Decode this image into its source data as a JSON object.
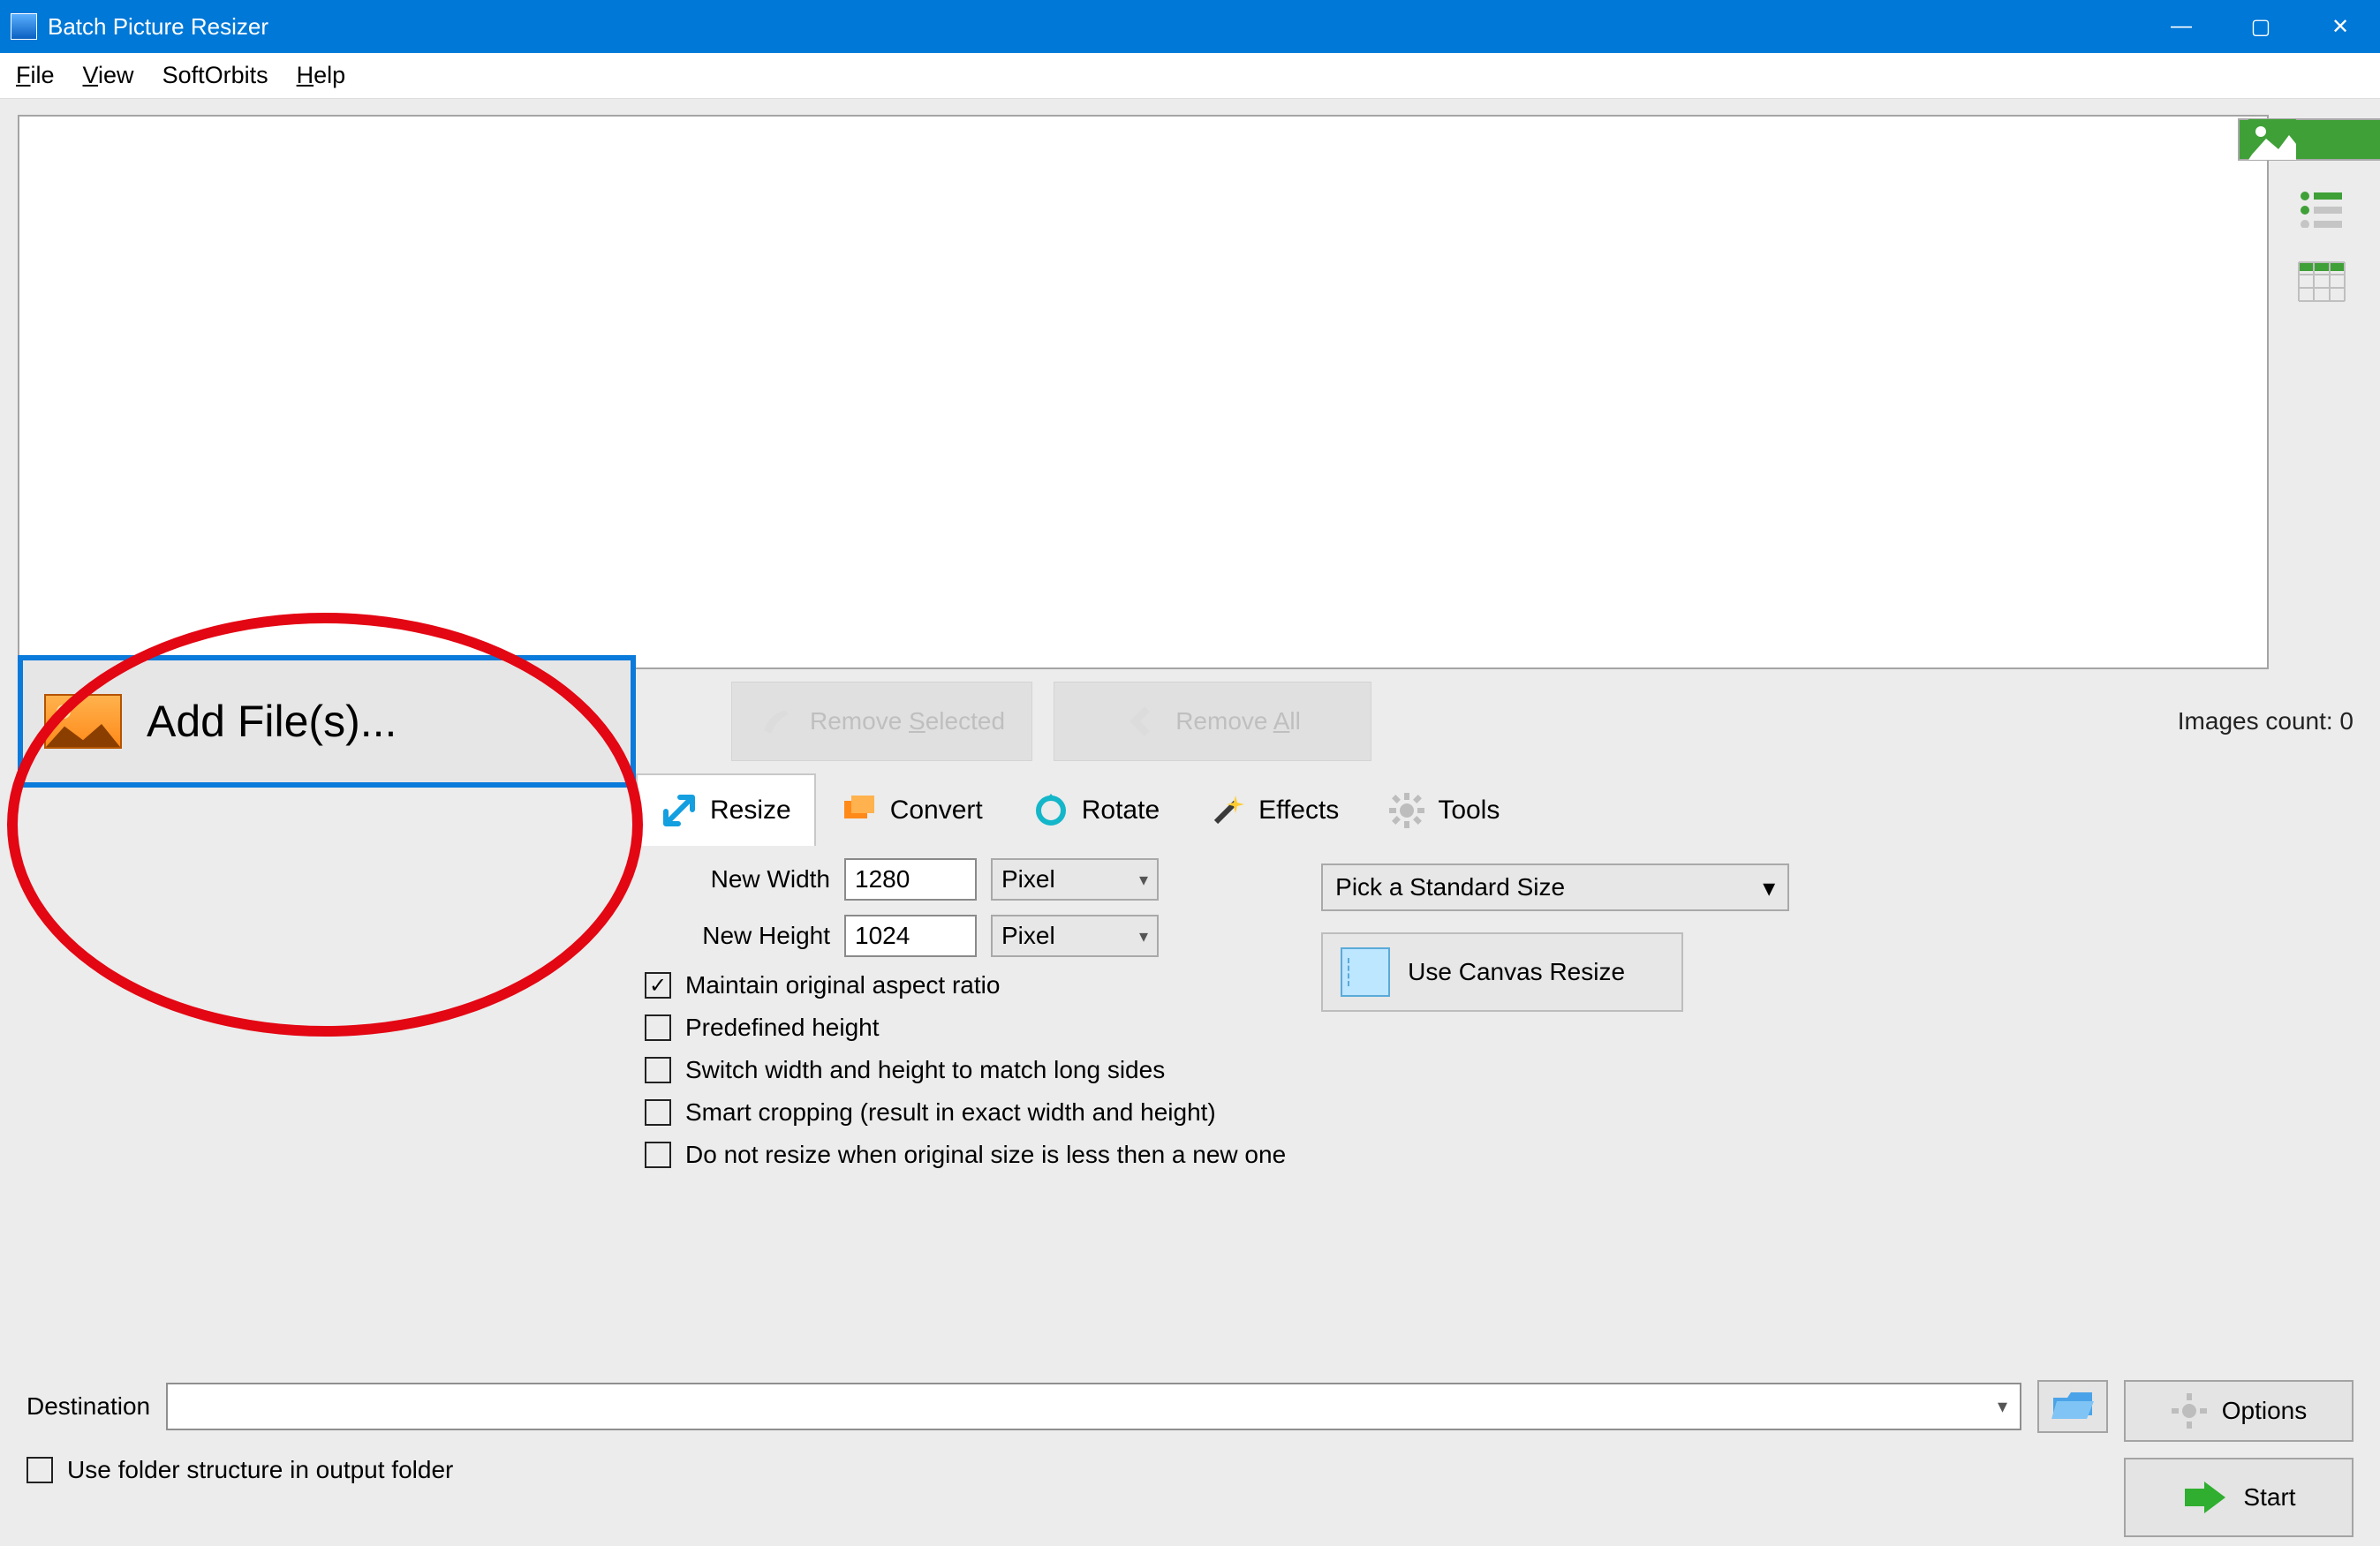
{
  "titlebar": {
    "title": "Batch Picture Resizer"
  },
  "menu": {
    "file": "File",
    "view": "View",
    "softorbits": "SoftOrbits",
    "help": "Help"
  },
  "toolbar": {
    "add_files": "Add File(s)...",
    "remove_selected": "Remove Selected",
    "remove_all": "Remove All",
    "images_count_label": "Images count:",
    "images_count_value": "0"
  },
  "tabs": {
    "resize": "Resize",
    "convert": "Convert",
    "rotate": "Rotate",
    "effects": "Effects",
    "tools": "Tools"
  },
  "resize": {
    "new_width_label": "New Width",
    "new_width_value": "1280",
    "new_width_unit": "Pixel",
    "new_height_label": "New Height",
    "new_height_value": "1024",
    "new_height_unit": "Pixel",
    "maintain_aspect": "Maintain original aspect ratio",
    "predefined_height": "Predefined height",
    "switch_wh": "Switch width and height to match long sides",
    "smart_crop": "Smart cropping (result in exact width and height)",
    "dont_resize": "Do not resize when original size is less then a new one",
    "pick_standard": "Pick a Standard Size",
    "use_canvas": "Use Canvas Resize"
  },
  "bottom": {
    "destination_label": "Destination",
    "use_folder_structure": "Use folder structure in output folder",
    "options": "Options",
    "start": "Start"
  }
}
